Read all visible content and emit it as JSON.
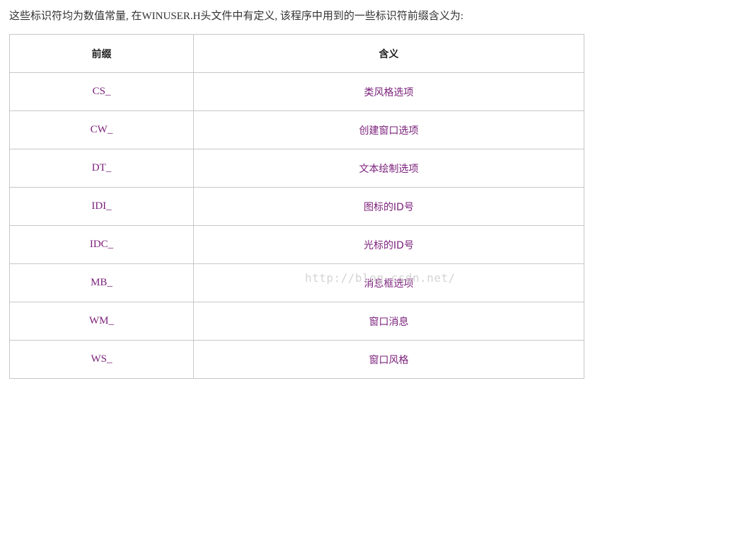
{
  "intro_text": "这些标识符均为数值常量, 在WINUSER.H头文件中有定义, 该程序中用到的一些标识符前缀含义为:",
  "table": {
    "headers": {
      "prefix": "前缀",
      "meaning": "含义"
    },
    "rows": [
      {
        "prefix": "CS_",
        "meaning": "类风格选项"
      },
      {
        "prefix": "CW_",
        "meaning": "创建窗口选项"
      },
      {
        "prefix": "DT_",
        "meaning": "文本绘制选项"
      },
      {
        "prefix": "IDI_",
        "meaning": "图标的ID号"
      },
      {
        "prefix": "IDC_",
        "meaning": "光标的ID号"
      },
      {
        "prefix": "MB_",
        "meaning": "消息框选项"
      },
      {
        "prefix": "WM_",
        "meaning": "窗口消息"
      },
      {
        "prefix": "WS_",
        "meaning": "窗口风格"
      }
    ]
  },
  "watermark": "http://blog.csdn.net/",
  "colors": {
    "text": "#333333",
    "cell_text": "#7a1f7a",
    "border": "#c8c8c8",
    "watermark": "#d4d4d4"
  }
}
